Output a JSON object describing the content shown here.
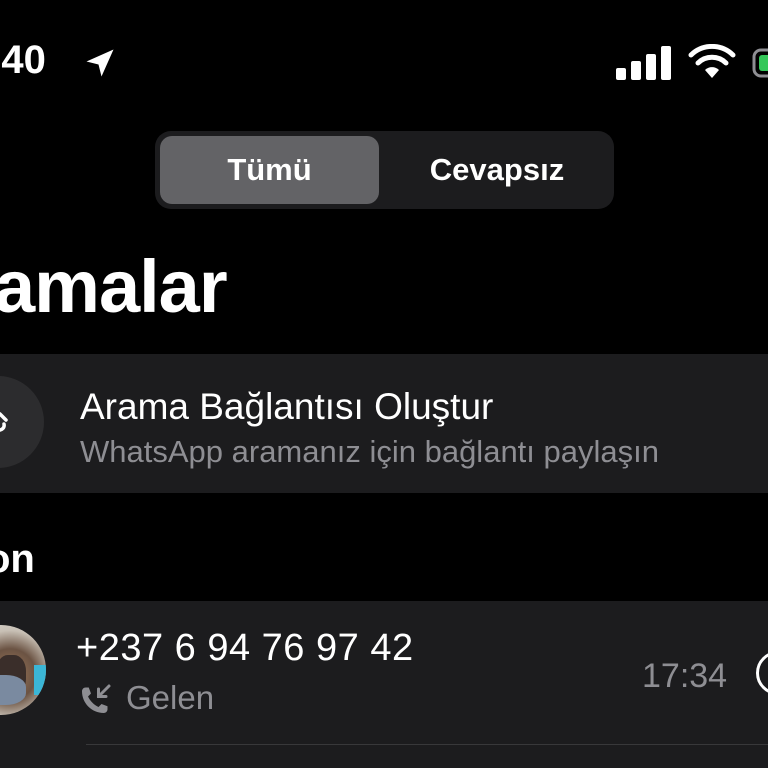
{
  "status_bar": {
    "time": ":40",
    "icons": [
      "location-arrow-icon",
      "cellular-signal-icon",
      "wifi-icon",
      "battery-icon"
    ],
    "battery_color": "#34c759"
  },
  "segmented_control": {
    "tabs": [
      {
        "label": "Tümü",
        "selected": true
      },
      {
        "label": "Cevapsız",
        "selected": false
      }
    ]
  },
  "page": {
    "title": "amalar"
  },
  "call_link": {
    "icon": "link-icon",
    "title": "Arama Bağlantısı Oluştur",
    "subtitle": "WhatsApp aramanız için bağlantı paylaşın"
  },
  "section": {
    "header": "on"
  },
  "calls": [
    {
      "number": "+237 6 94 76 97 42",
      "type_icon": "incoming-call-icon",
      "type": "Gelen",
      "time": "17:34",
      "info_icon": "info-icon"
    }
  ],
  "colors": {
    "background": "#000000",
    "surface": "#1c1c1e",
    "selected_tab": "#636366",
    "secondary_text": "#8e8e93"
  }
}
